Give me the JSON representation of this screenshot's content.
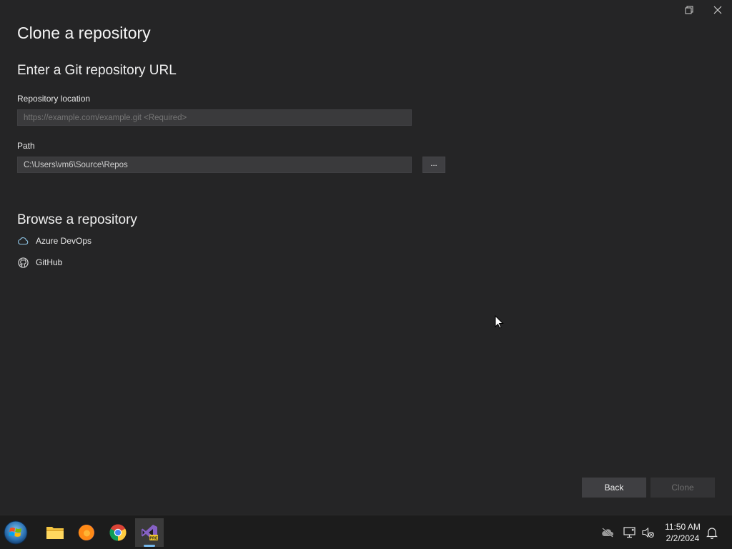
{
  "dialog": {
    "title": "Clone a repository",
    "url_section": {
      "heading": "Enter a Git repository URL",
      "repo_location_label": "Repository location",
      "repo_location_placeholder": "https://example.com/example.git <Required>",
      "repo_location_value": "",
      "path_label": "Path",
      "path_value": "C:\\Users\\vm6\\Source\\Repos",
      "browse_button": "..."
    },
    "browse_section": {
      "heading": "Browse a repository",
      "items": [
        {
          "label": "Azure DevOps",
          "icon": "cloud-icon"
        },
        {
          "label": "GitHub",
          "icon": "github-icon"
        }
      ]
    },
    "buttons": {
      "back": "Back",
      "clone": "Clone"
    }
  },
  "window_controls": [
    "restore-icon",
    "close-icon"
  ],
  "taskbar": {
    "apps": [
      {
        "name": "File Explorer",
        "icon": "folder-icon"
      },
      {
        "name": "Firefox",
        "icon": "firefox-icon"
      },
      {
        "name": "Chrome",
        "icon": "chrome-icon"
      },
      {
        "name": "Visual Studio Preview",
        "icon": "visual-studio-icon",
        "active": true
      }
    ],
    "tray": [
      "onedrive-offline-icon",
      "network-icon",
      "volume-muted-icon",
      "notification-icon"
    ],
    "clock": {
      "time": "11:50 AM",
      "date": "2/2/2024"
    }
  },
  "colors": {
    "background": "#252526",
    "input_bg": "#3a3a3c",
    "button_bg": "#3f3f42",
    "accent": "#76b9ed"
  }
}
